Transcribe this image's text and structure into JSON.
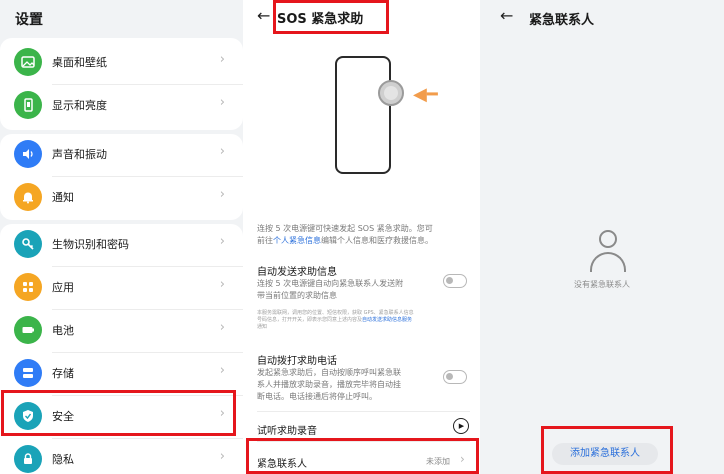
{
  "settings": {
    "title": "设置",
    "items": [
      {
        "label": "桌面和壁纸",
        "icon": "image-icon",
        "color": "#3bb44a"
      },
      {
        "label": "显示和亮度",
        "icon": "phone-display-icon",
        "color": "#3bb44a"
      },
      {
        "label": "声音和振动",
        "icon": "volume-icon",
        "color": "#2f7cf6"
      },
      {
        "label": "通知",
        "icon": "bell-icon",
        "color": "#f5a623"
      },
      {
        "label": "生物识别和密码",
        "icon": "key-icon",
        "color": "#1aa3b8"
      },
      {
        "label": "应用",
        "icon": "apps-grid-icon",
        "color": "#f5a623"
      },
      {
        "label": "电池",
        "icon": "battery-icon",
        "color": "#3bb44a"
      },
      {
        "label": "存储",
        "icon": "storage-icon",
        "color": "#2f7cf6"
      },
      {
        "label": "安全",
        "icon": "shield-icon",
        "color": "#1aa3b8"
      },
      {
        "label": "隐私",
        "icon": "privacy-icon",
        "color": "#1aa3b8"
      }
    ]
  },
  "sos": {
    "title": "SOS 紧急求助",
    "intro_a": "连按 5 次电源键可快速发起 SOS 紧急求助。您可",
    "intro_b_prefix": "前往",
    "intro_b_link": "个人紧急信息",
    "intro_b_suffix": "编辑个人信息和医疗救援信息。",
    "auto_send": {
      "title": "自动发送求助信息",
      "desc_1": "连按 5 次电源键自动向紧急联系人发送附",
      "desc_2": "带当前位置的求助信息"
    },
    "fine_print_1": "本服务需联网，调用您的位置、短信权限，获取 GPS、紧急联系人信息",
    "fine_print_2": "号码信息，打开开关，即表示您同意上述内容及",
    "fine_print_link": "自动发送求助信息服务",
    "fine_print_3": "通知",
    "auto_call": {
      "title": "自动拨打求助电话",
      "desc_1": "发起紧急求助后，自动按顺序呼叫紧急联",
      "desc_2": "系人并播放求助录音，播放完毕将自动挂",
      "desc_3": "断电话。电话接通后将停止呼叫。"
    },
    "listen_label": "试听求助录音",
    "contacts_label": "紧急联系人",
    "contacts_value": "未添加"
  },
  "contacts": {
    "title": "紧急联系人",
    "empty_text": "没有紧急联系人",
    "add_button": "添加紧急联系人"
  },
  "colors": {
    "highlight": "#e5161c",
    "link": "#2a6fdb",
    "accent_orange": "#f29c4b"
  }
}
